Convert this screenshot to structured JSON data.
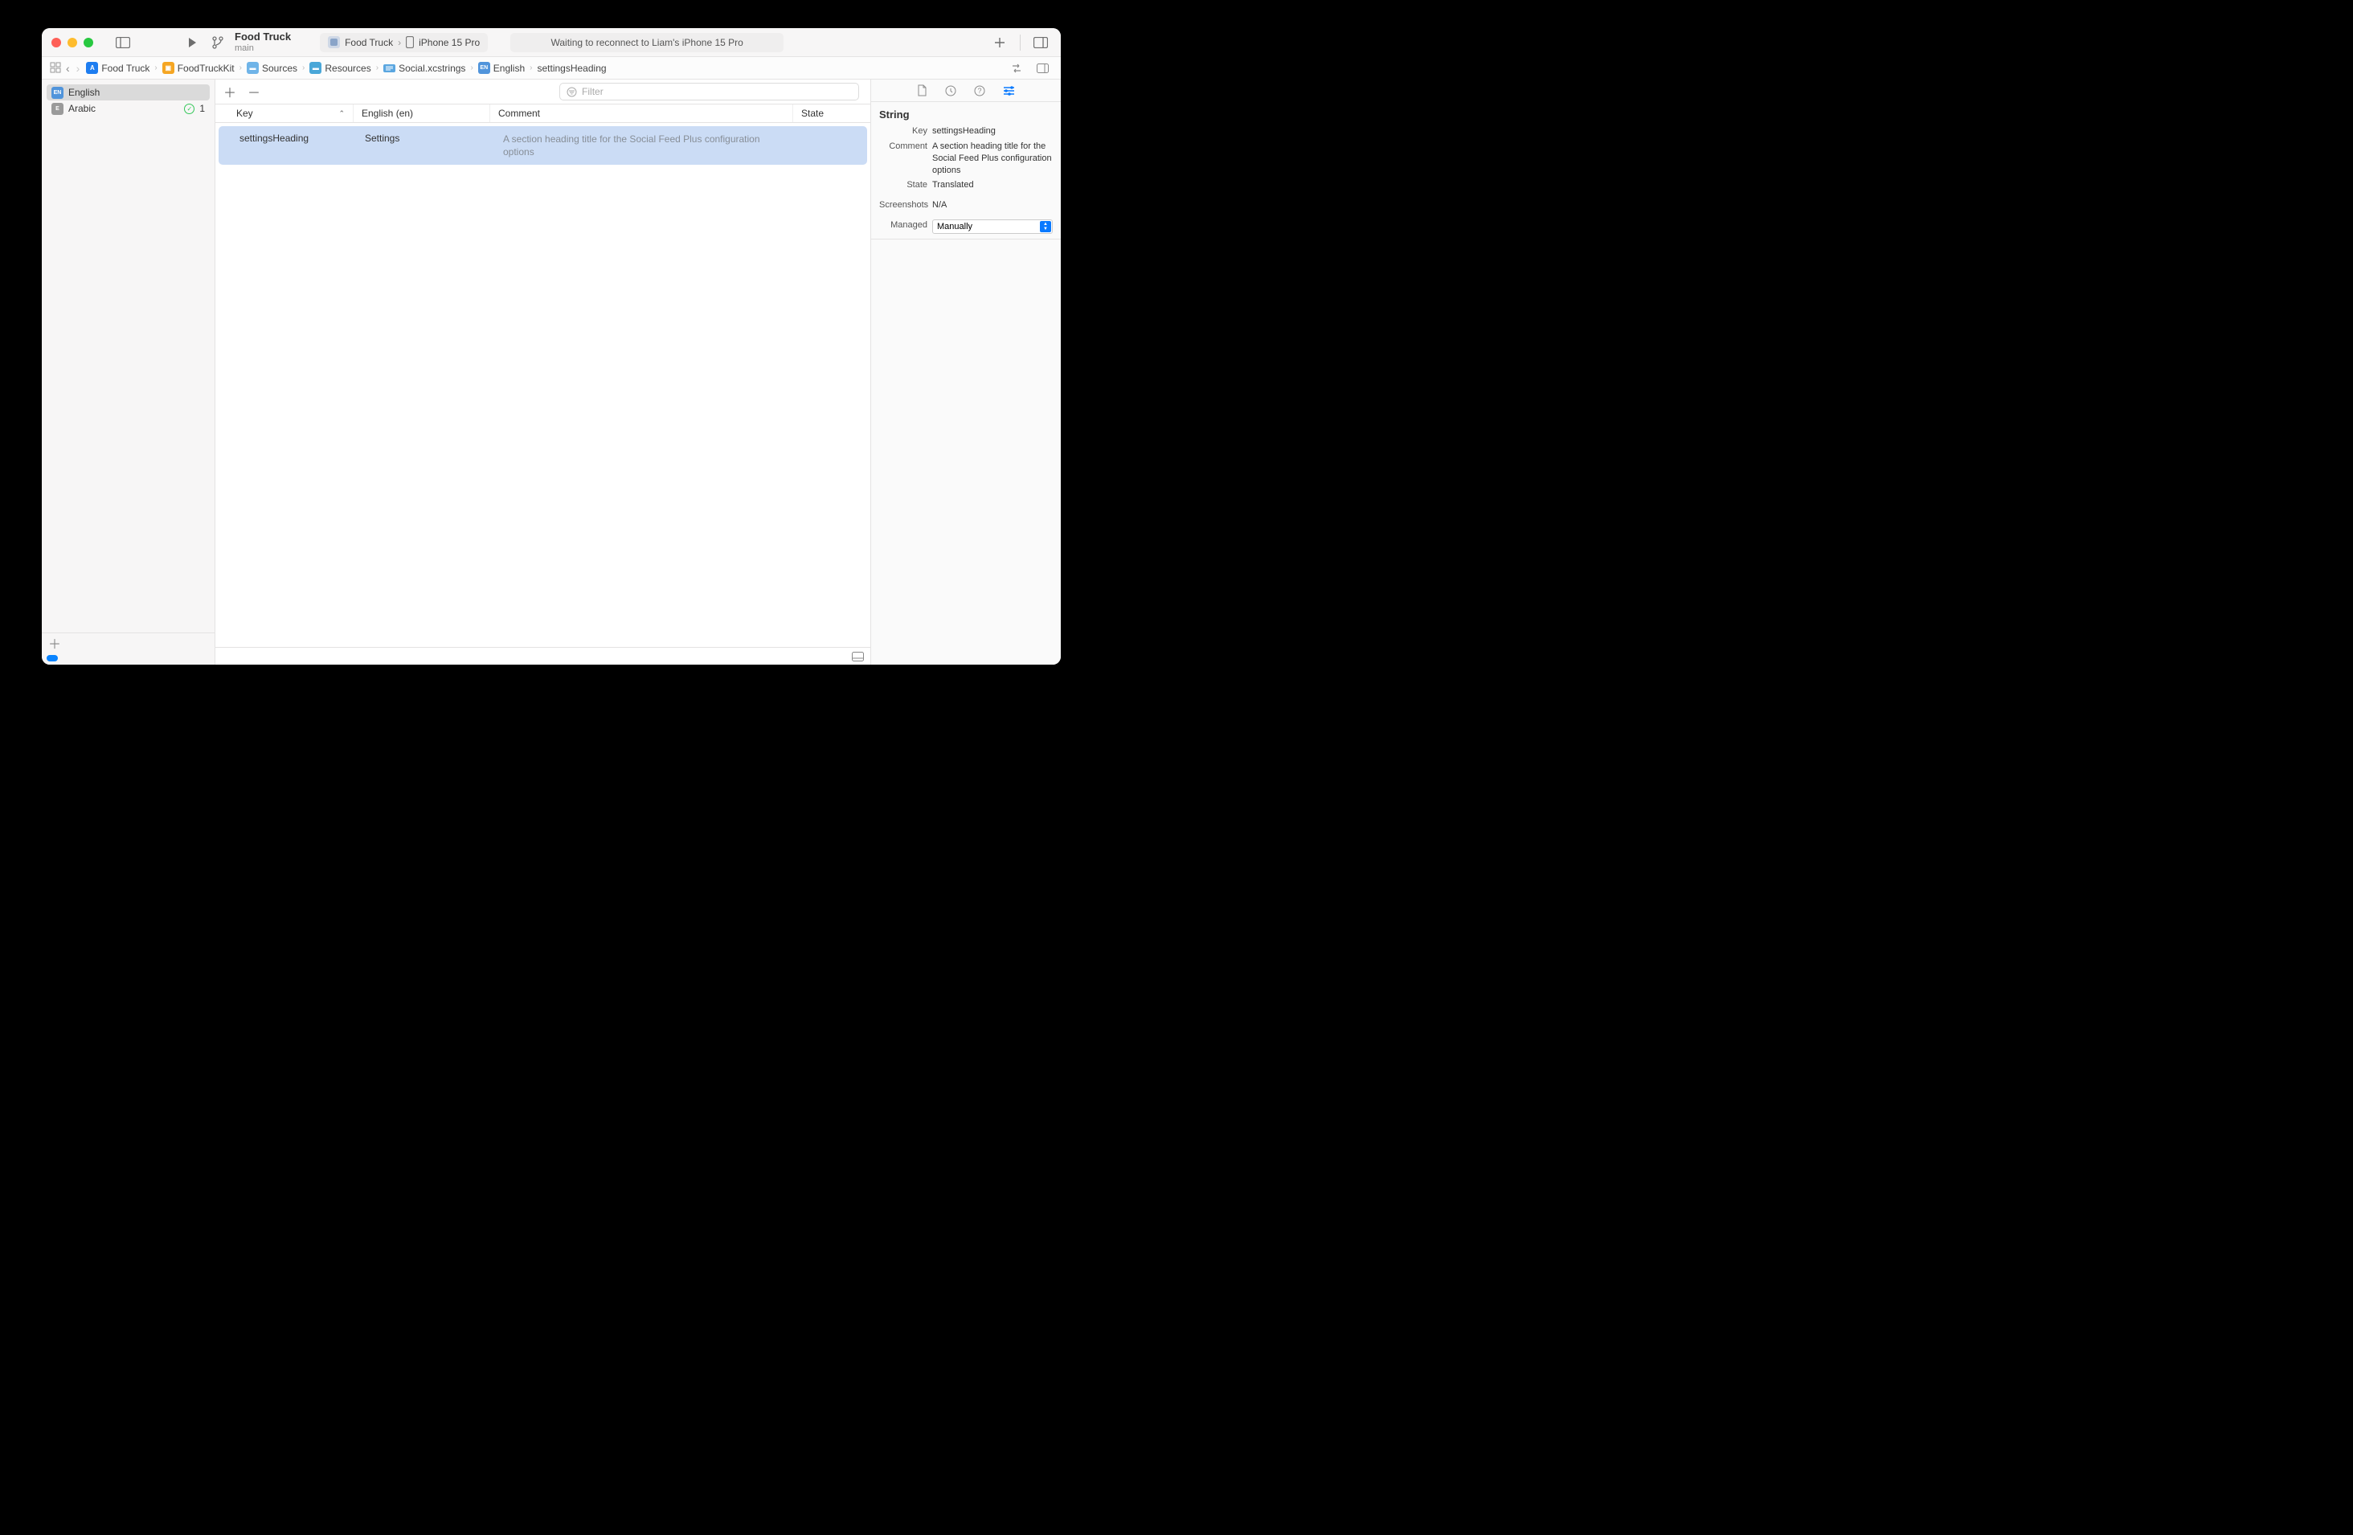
{
  "project": {
    "name": "Food Truck",
    "branch": "main"
  },
  "scheme": {
    "target": "Food Truck",
    "device": "iPhone 15 Pro"
  },
  "status": "Waiting to reconnect to Liam's iPhone 15 Pro",
  "breadcrumb": {
    "items": [
      "Food Truck",
      "FoodTruckKit",
      "Sources",
      "Resources",
      "Social.xcstrings",
      "English",
      "settingsHeading"
    ]
  },
  "sidebar": {
    "languages": [
      {
        "badge": "EN",
        "name": "English",
        "selected": true,
        "status": "none"
      },
      {
        "badge": "E",
        "name": "Arabic",
        "selected": false,
        "status": "ok"
      }
    ]
  },
  "table": {
    "headers": {
      "key": "Key",
      "english": "English (en)",
      "comment": "Comment",
      "state": "State"
    },
    "filter_placeholder": "Filter",
    "rows": [
      {
        "key": "settingsHeading",
        "english": "Settings",
        "comment": "A section heading title for the Social Feed Plus configuration options",
        "state": ""
      }
    ]
  },
  "inspector": {
    "section": "String",
    "key_label": "Key",
    "key_value": "settingsHeading",
    "comment_label": "Comment",
    "comment_value": "A section heading title for the Social Feed Plus configuration options",
    "state_label": "State",
    "state_value": "Translated",
    "screenshots_label": "Screenshots",
    "screenshots_value": "N/A",
    "managed_label": "Managed",
    "managed_value": "Manually"
  }
}
